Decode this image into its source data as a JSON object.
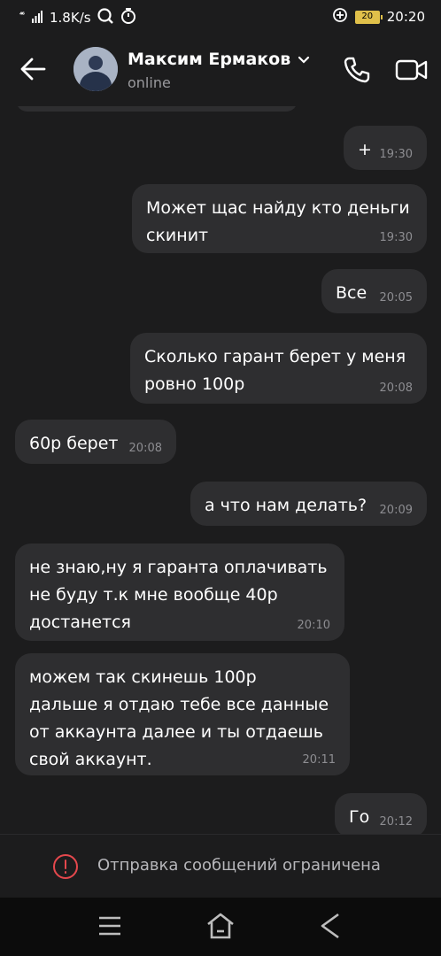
{
  "status_bar": {
    "signal": "⁴⁶",
    "net_speed": "1.8K/s",
    "battery": "20",
    "time": "20:20"
  },
  "header": {
    "name": "Максим Ермаков",
    "status": "online"
  },
  "messages": [
    {
      "text": "+",
      "time": "19:30",
      "side": "out"
    },
    {
      "text": "Может щас найду кто деньги\nскинит",
      "time": "19:30",
      "side": "out"
    },
    {
      "text": "Все",
      "time": "20:05",
      "side": "out"
    },
    {
      "text": "Сколько гарант берет у меня\nровно 100р",
      "time": "20:08",
      "side": "out"
    },
    {
      "text": "60р берет",
      "time": "20:08",
      "side": "in"
    },
    {
      "text": "а что нам делать?",
      "time": "20:09",
      "side": "out"
    },
    {
      "text": "не знаю,ну я гаранта оплачивать\nне буду т.к мне вообще 40р\nдостанется",
      "time": "20:10",
      "side": "in"
    },
    {
      "text": "можем так скинешь 100р\nдальше я отдаю тебе все данные\nот аккаунта далее и ты отдаешь\nсвой аккаунт.",
      "time": "20:11",
      "side": "in"
    },
    {
      "text": "Го",
      "time": "20:12",
      "side": "out"
    }
  ],
  "restricted": {
    "text": "Отправка сообщений ограничена",
    "color": "#e5484d"
  },
  "colors": {
    "background": "#1c1c1d",
    "bubble": "#2e2e30"
  }
}
